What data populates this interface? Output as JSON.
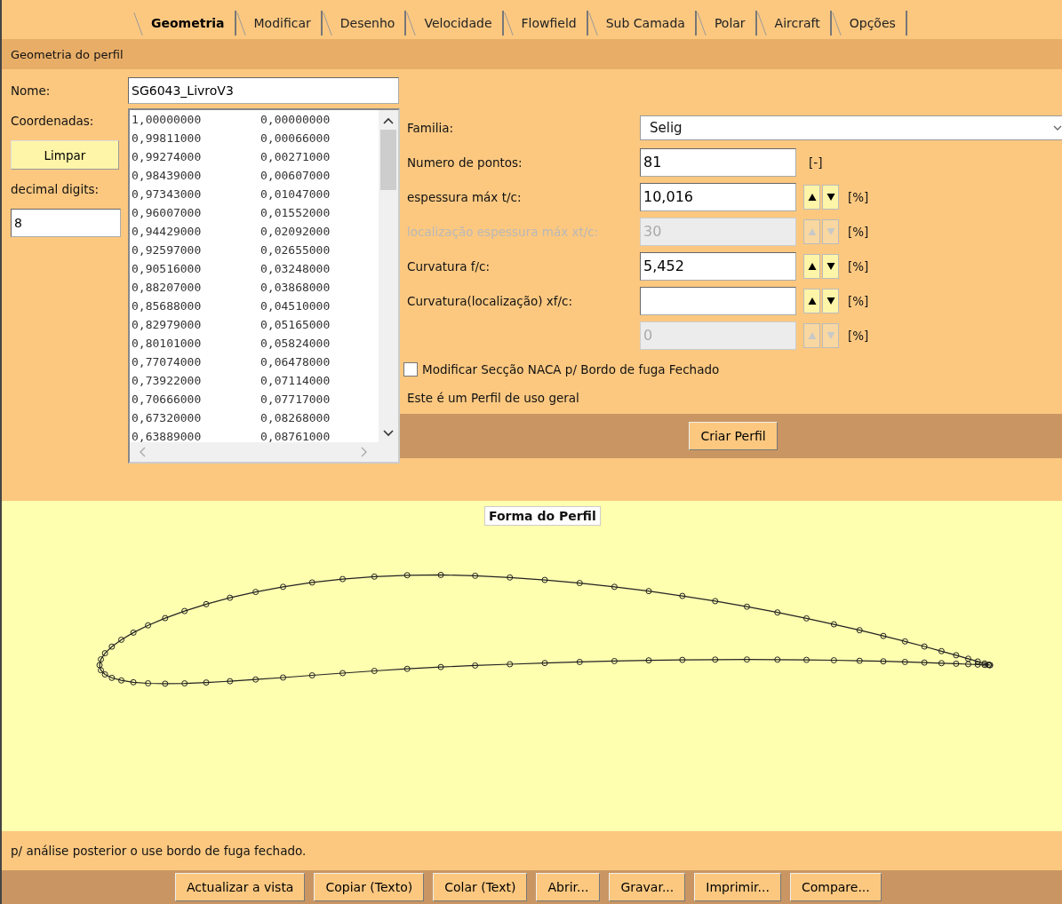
{
  "tabs": [
    {
      "label": "Geometria",
      "selected": true
    },
    {
      "label": "Modificar",
      "selected": false
    },
    {
      "label": "Desenho",
      "selected": false
    },
    {
      "label": "Velocidade",
      "selected": false
    },
    {
      "label": "Flowfield",
      "selected": false
    },
    {
      "label": "Sub Camada",
      "selected": false
    },
    {
      "label": "Polar",
      "selected": false
    },
    {
      "label": "Aircraft",
      "selected": false
    },
    {
      "label": "Opções",
      "selected": false
    }
  ],
  "section_title": "Geometria do perfil",
  "name": {
    "label": "Nome:",
    "value": "SG6043_LivroV3"
  },
  "coordinates": {
    "label": "Coordenadas:",
    "clear_button": "Limpar",
    "digits_label": "decimal digits:",
    "digits_value": "8",
    "rows": [
      [
        "1,00000000",
        "0,00000000"
      ],
      [
        "0,99811000",
        "0,00066000"
      ],
      [
        "0,99274000",
        "0,00271000"
      ],
      [
        "0,98439000",
        "0,00607000"
      ],
      [
        "0,97343000",
        "0,01047000"
      ],
      [
        "0,96007000",
        "0,01552000"
      ],
      [
        "0,94429000",
        "0,02092000"
      ],
      [
        "0,92597000",
        "0,02655000"
      ],
      [
        "0,90516000",
        "0,03248000"
      ],
      [
        "0,88207000",
        "0,03868000"
      ],
      [
        "0,85688000",
        "0,04510000"
      ],
      [
        "0,82979000",
        "0,05165000"
      ],
      [
        "0,80101000",
        "0,05824000"
      ],
      [
        "0,77074000",
        "0,06478000"
      ],
      [
        "0,73922000",
        "0,07114000"
      ],
      [
        "0,70666000",
        "0,07717000"
      ],
      [
        "0,67320000",
        "0,08268000"
      ],
      [
        "0,63889000",
        "0,08761000"
      ]
    ]
  },
  "params": [
    {
      "kind": "select",
      "label": "Familia:",
      "value": "Selig",
      "disabled": false
    },
    {
      "kind": "field",
      "label": "Numero de pontos:",
      "value": "81",
      "unit": "[-]",
      "disabled": false
    },
    {
      "kind": "spin",
      "label": "espessura máx t/c:",
      "value": "10,016",
      "unit": "[%]",
      "disabled": false
    },
    {
      "kind": "spin",
      "label": "localização espessura máx xt/c:",
      "value": "30",
      "unit": "[%]",
      "disabled": true
    },
    {
      "kind": "spin",
      "label": "Curvatura  f/c:",
      "value": "5,452",
      "unit": "[%]",
      "disabled": false
    },
    {
      "kind": "spin",
      "label": "Curvatura(localização) xf/c:",
      "unit": "[%]",
      "disabled": false
    },
    {
      "kind": "spin",
      "value": "0",
      "unit": "[%]",
      "disabled": true
    }
  ],
  "naca_checkbox": {
    "label": "Modificar Secção NACA p/ Bordo de fuga Fechado",
    "checked": false
  },
  "profile_note": "Este é um Perfil de uso geral",
  "create_button": "Criar Perfil",
  "plot": {
    "title": "Forma do Perfil"
  },
  "status": "p/ análise posterior o use bordo de fuga fechado.",
  "buttons": [
    "Actualizar a vista",
    "Copiar (Texto)",
    "Colar (Text)",
    "Abrir...",
    "Gravar...",
    "Imprimir...",
    "Compare..."
  ]
}
